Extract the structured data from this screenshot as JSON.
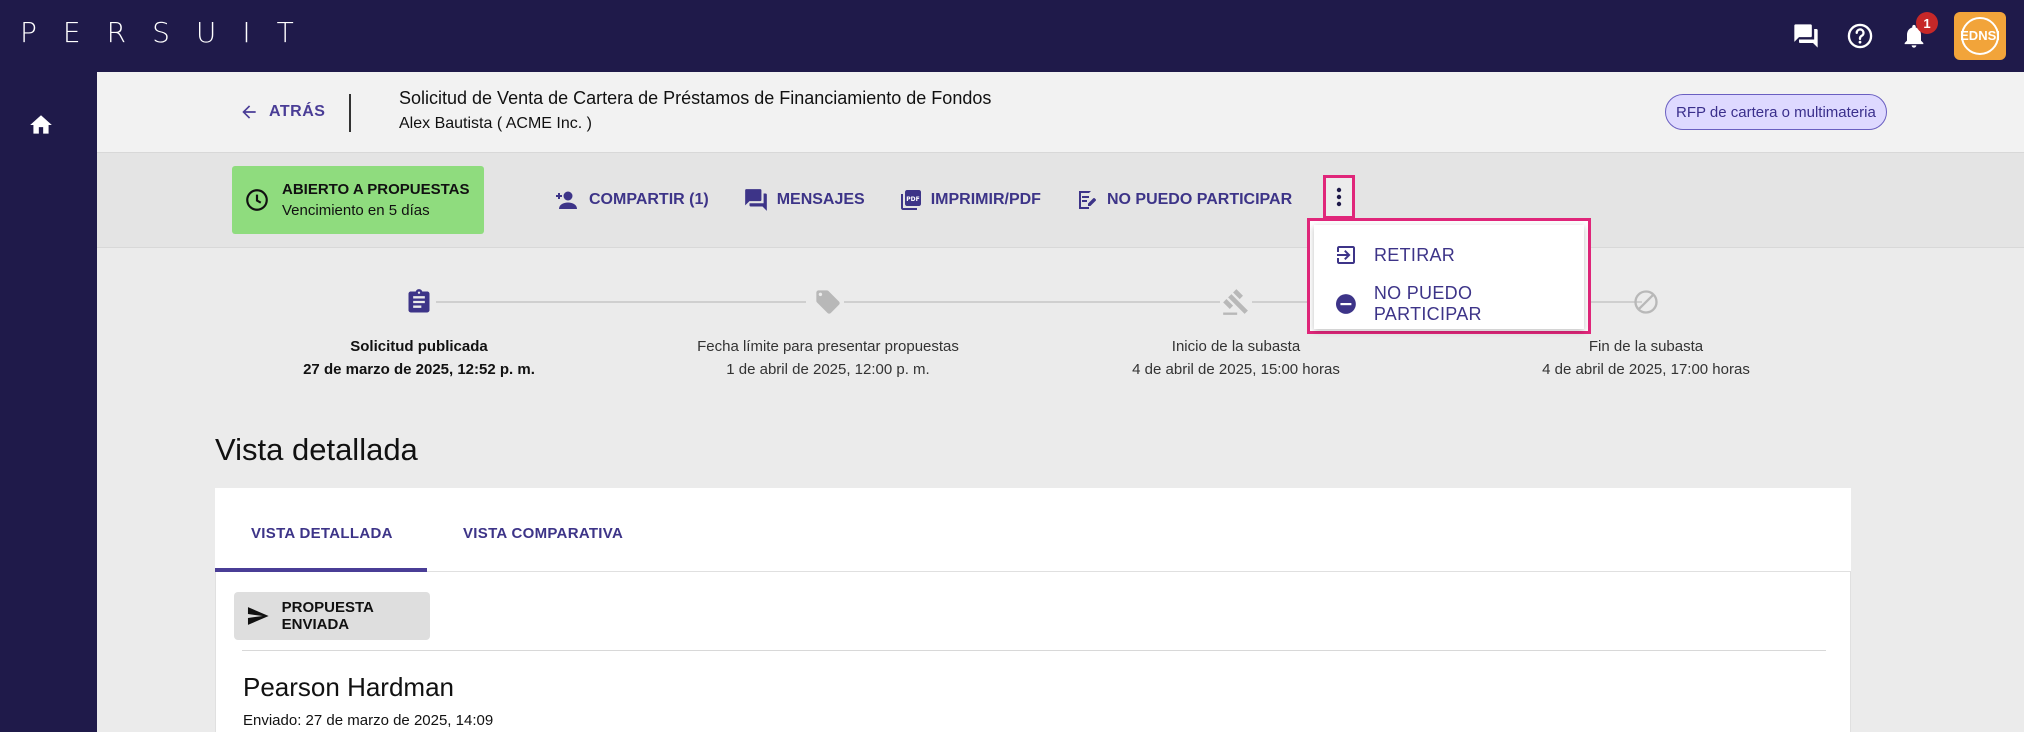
{
  "brand": {
    "letters": [
      "P",
      "E",
      "R",
      "S",
      "U",
      "I",
      "T"
    ]
  },
  "topbar": {
    "icons": [
      "chat-icon",
      "help-icon",
      "bell-icon"
    ],
    "notification_count": "1",
    "avatar_text": "EDNSI",
    "avatar_color": "#f2a43a"
  },
  "colors": {
    "nav_bg": "#1f1a4a",
    "accent": "#4a3d96",
    "highlight": "#e0267a",
    "status_green": "#8fdc7e"
  },
  "header": {
    "back_label": "ATRÁS",
    "title": "Solicitud de Venta de Cartera de Préstamos de Financiamiento de Fondos",
    "subtitle": "Alex Bautista ( ACME Inc. )",
    "rfp_badge": "RFP de cartera o multimateria"
  },
  "status": {
    "title": "ABIERTO A PROPUESTAS",
    "subtitle": "Vencimiento en 5 días"
  },
  "actions": {
    "share": "COMPARTIR (1)",
    "messages": "MENSAJES",
    "print": "IMPRIMIR/PDF",
    "decline": "NO PUEDO PARTICIPAR"
  },
  "dropdown": {
    "items": [
      {
        "label": "RETIRAR",
        "icon": "exit-icon"
      },
      {
        "label": "NO PUEDO PARTICIPAR",
        "icon": "minus-circle-icon"
      }
    ]
  },
  "timeline": {
    "steps": [
      {
        "label": "Solicitud publicada",
        "date": "27 de marzo de 2025, 12:52 p. m.",
        "icon": "clipboard-icon"
      },
      {
        "label": "Fecha límite para presentar propuestas",
        "date": "1 de abril de 2025, 12:00 p. m.",
        "icon": "tag-icon"
      },
      {
        "label": "Inicio de la subasta",
        "date": "4 de abril de 2025, 15:00 horas",
        "icon": "gavel-icon"
      },
      {
        "label": "Fin de la subasta",
        "date": "4 de abril de 2025, 17:00 horas",
        "icon": "block-icon"
      }
    ]
  },
  "main": {
    "section_title": "Vista detallada",
    "tabs": [
      {
        "label": "VISTA DETALLADA"
      },
      {
        "label": "VISTA COMPARATIVA"
      }
    ],
    "sent_button": "PROPUESTA ENVIADA",
    "firm_name": "Pearson Hardman",
    "sent_date": "Enviado: 27 de marzo de 2025, 14:09"
  }
}
